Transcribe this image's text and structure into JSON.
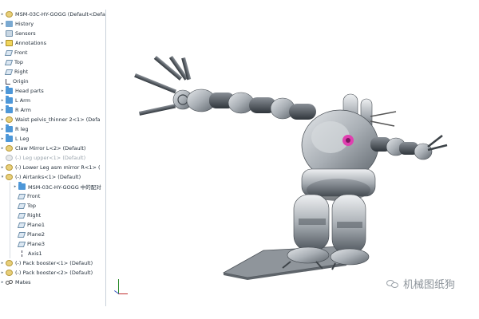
{
  "feature_tree": {
    "root": "MSM-03C-HY-GOGG  (Default<Defaul",
    "items": [
      {
        "label": "History",
        "icon": "history-icon"
      },
      {
        "label": "Sensors",
        "icon": "sensor-icon"
      },
      {
        "label": "Annotations",
        "icon": "annotation-icon"
      },
      {
        "label": "Front",
        "icon": "plane-icon"
      },
      {
        "label": "Top",
        "icon": "plane-icon"
      },
      {
        "label": "Right",
        "icon": "plane-icon"
      },
      {
        "label": "Origin",
        "icon": "origin-icon"
      },
      {
        "label": "Head parts",
        "icon": "folder-icon"
      },
      {
        "label": "L Arm",
        "icon": "folder-icon"
      },
      {
        "label": "R Arm",
        "icon": "folder-icon"
      },
      {
        "label": "Waist pelvis_thinner 2<1> (Defa",
        "icon": "part-icon"
      },
      {
        "label": "R leg",
        "icon": "folder-icon"
      },
      {
        "label": "L Leg",
        "icon": "folder-icon"
      },
      {
        "label": "Claw Mirror L<2> (Default)",
        "icon": "part-icon"
      },
      {
        "label": "(-) Leg upper<1> (Default)",
        "icon": "faded-part-icon"
      },
      {
        "label": "(-) Lower Leg asm mirror R<1> (",
        "icon": "part-icon"
      },
      {
        "label": "(-) Airtanks<1> (Default)",
        "icon": "part-icon"
      },
      {
        "label": "MSM-03C-HY-GOGG 中的配对",
        "icon": "folder-icon"
      },
      {
        "label": "Front",
        "icon": "plane-icon"
      },
      {
        "label": "Top",
        "icon": "plane-icon"
      },
      {
        "label": "Right",
        "icon": "plane-icon"
      },
      {
        "label": "Plane1",
        "icon": "plane-icon"
      },
      {
        "label": "Plane2",
        "icon": "plane-icon"
      },
      {
        "label": "Plane3",
        "icon": "plane-icon"
      },
      {
        "label": "Axis1",
        "icon": "axis-icon"
      },
      {
        "label": "(-) Pack booster<1> (Default)",
        "icon": "part-icon"
      },
      {
        "label": "(-) Pack booster<2> (Default)",
        "icon": "part-icon"
      },
      {
        "label": "Mates",
        "icon": "mates-icon"
      }
    ]
  },
  "watermark": {
    "text": "机械图纸狗"
  },
  "colors": {
    "accent": "#4d97d8",
    "joint_highlight": "#e040b0",
    "model_gray": "#a8aeb4"
  }
}
